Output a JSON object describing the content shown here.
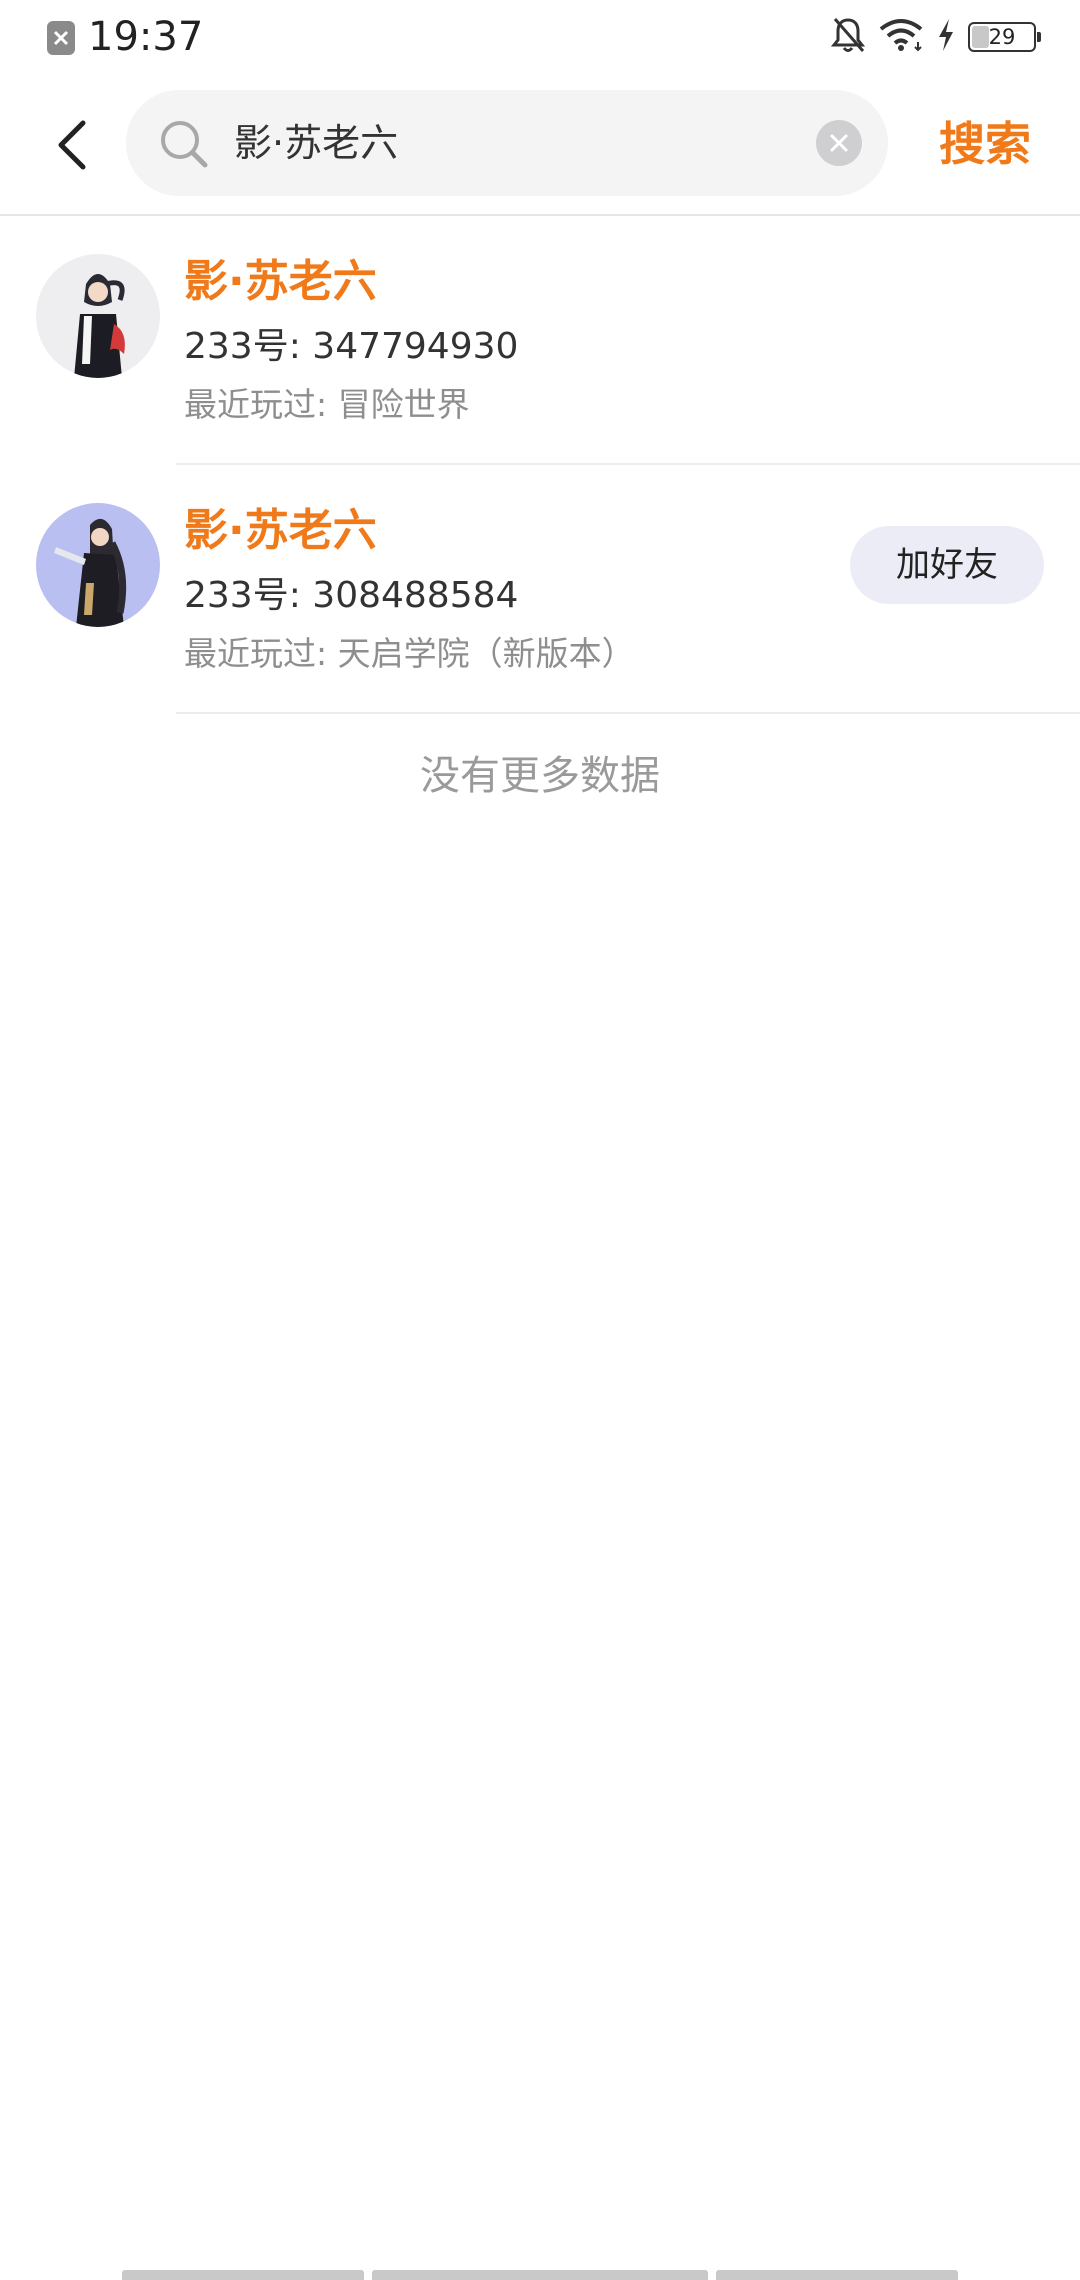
{
  "status_bar": {
    "time": "19:37",
    "battery_text": "29",
    "battery_level": 0.29,
    "icons": [
      "app-notification-icon",
      "bell-off-icon",
      "wifi-icon",
      "charging-icon",
      "battery-icon"
    ]
  },
  "header": {
    "search_value": "影·苏老六",
    "search_button": "搜索"
  },
  "results": [
    {
      "name": "影·苏老六",
      "id_line": "233号: 347794930",
      "recent": "最近玩过: 冒险世界",
      "has_add_button": false
    },
    {
      "name": "影·苏老六",
      "id_line": "233号: 308488584",
      "recent": "最近玩过: 天启学院（新版本）",
      "has_add_button": true,
      "add_button": "加好友"
    }
  ],
  "footer_text": "没有更多数据",
  "colors": {
    "accent": "#f07a1a",
    "search_bg": "#f4f4f5",
    "button_bg": "#ececf6"
  }
}
